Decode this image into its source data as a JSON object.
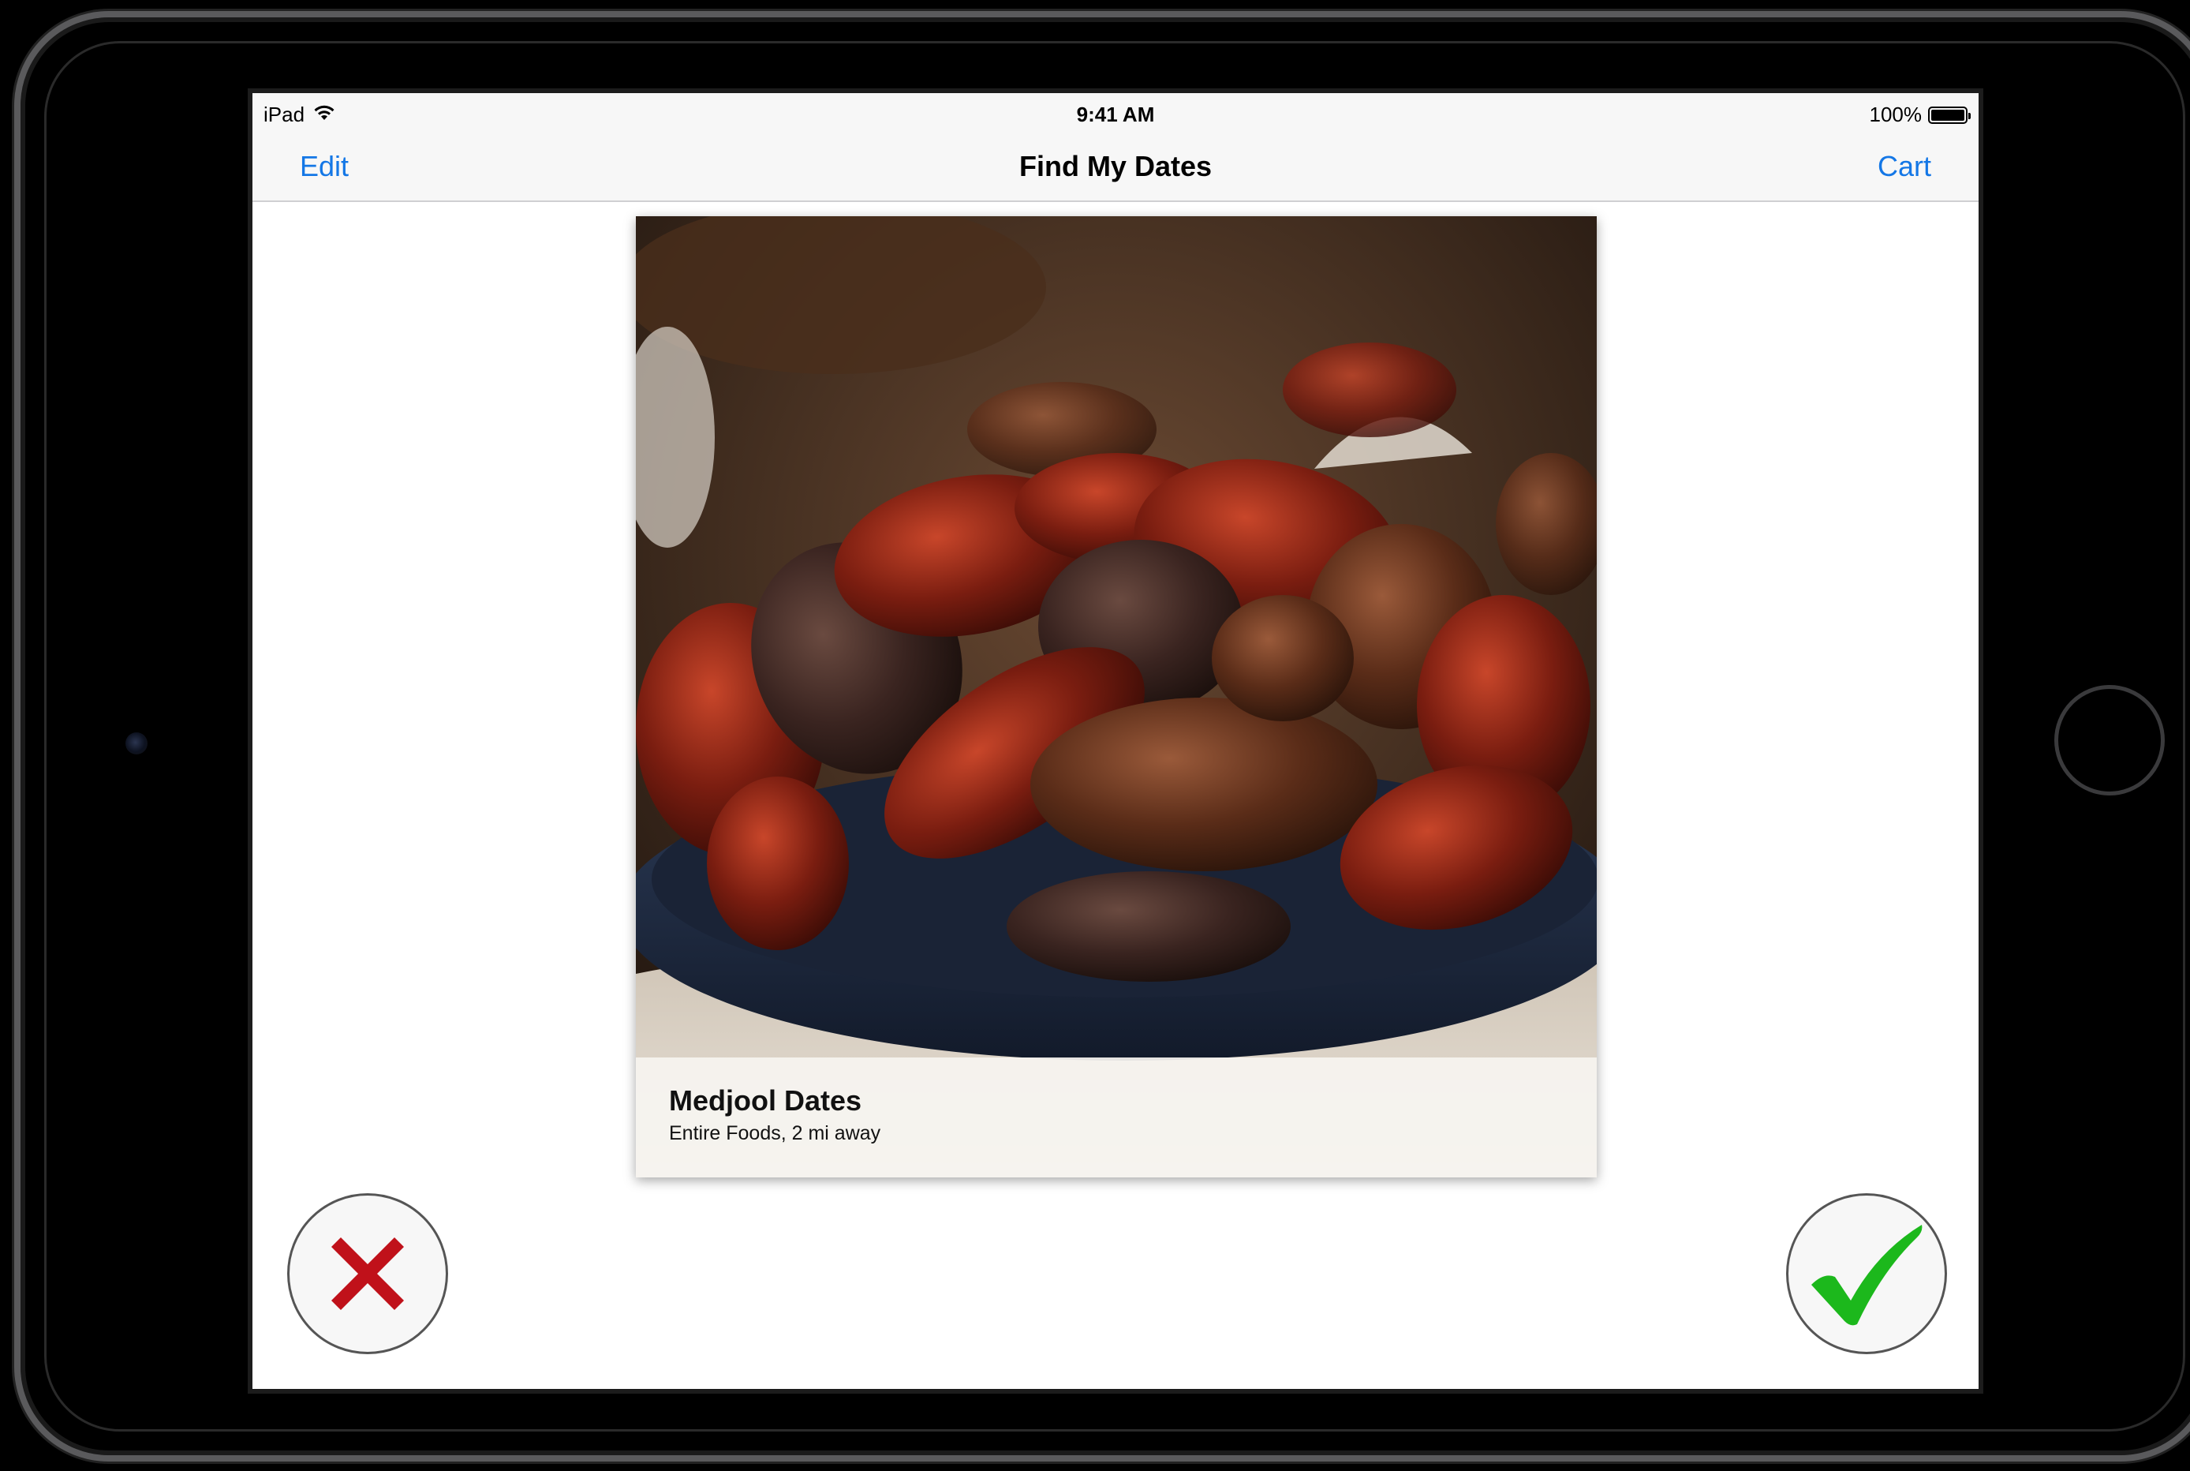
{
  "status_bar": {
    "device": "iPad",
    "time": "9:41 AM",
    "battery": "100%",
    "battery_level": 1.0
  },
  "nav": {
    "left_button": "Edit",
    "title": "Find My Dates",
    "right_button": "Cart"
  },
  "card": {
    "title": "Medjool Dates",
    "subtitle": "Entire Foods, 2 mi away",
    "photo_subject": "bowl-of-medjool-dates"
  },
  "actions": {
    "reject_icon": "red-x-icon",
    "accept_icon": "green-checkmark-icon"
  },
  "colors": {
    "tint": "#1477e6",
    "reject": "#c0111a",
    "accept": "#1cb81c"
  }
}
